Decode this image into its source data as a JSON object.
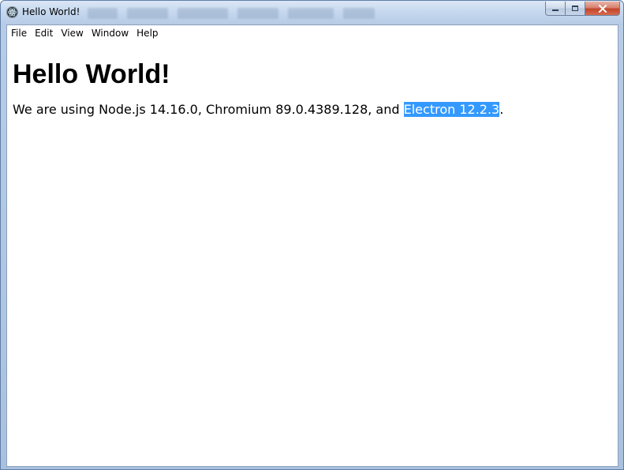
{
  "window": {
    "title": "Hello World!"
  },
  "menu": {
    "items": [
      "File",
      "Edit",
      "View",
      "Window",
      "Help"
    ]
  },
  "page": {
    "heading": "Hello World!",
    "text_before": "We are using Node.js 14.16.0, Chromium 89.0.4389.128, and ",
    "selected_text": "Electron 12.2.3",
    "text_after": "."
  },
  "caption_buttons": {
    "minimize_icon": "minimize-icon",
    "maximize_icon": "maximize-icon",
    "close_icon": "close-icon"
  },
  "colors": {
    "selection": "#3399ff",
    "close_button": "#c2462b"
  }
}
